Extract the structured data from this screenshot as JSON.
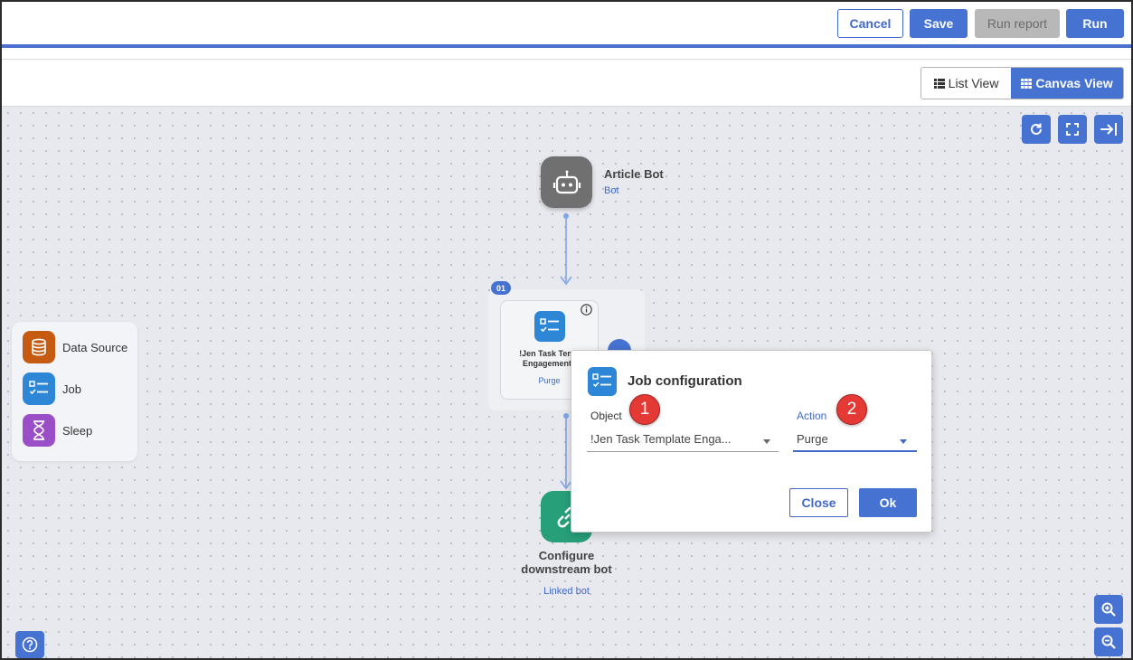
{
  "toolbar": {
    "cancel_label": "Cancel",
    "save_label": "Save",
    "run_report_label": "Run report",
    "run_label": "Run"
  },
  "view_switch": {
    "list_label": "List View",
    "canvas_label": "Canvas View",
    "active": "Canvas View"
  },
  "palette": {
    "items": [
      {
        "label": "Data Source",
        "icon": "database-icon",
        "color": "#c55a11"
      },
      {
        "label": "Job",
        "icon": "task-list-icon",
        "color": "#2d86d6"
      },
      {
        "label": "Sleep",
        "icon": "hourglass-icon",
        "color": "#9b4fc7"
      }
    ]
  },
  "nodes": {
    "bot": {
      "title": "Article Bot",
      "subtitle": "Bot",
      "icon": "robot-icon",
      "color": "#707070"
    },
    "job": {
      "badge": "01",
      "title_line1": "!Jen Task Temp",
      "title_line2": "Engagements",
      "subtitle": "Purge",
      "icon": "task-list-icon"
    },
    "linked": {
      "title_line1": "Configure",
      "title_line2": "downstream bot",
      "subtitle": "Linked bot",
      "icon": "link-icon",
      "color": "#27a07a"
    }
  },
  "dialog": {
    "title": "Job configuration",
    "object_label": "Object",
    "object_value": "!Jen Task Template Enga...",
    "action_label": "Action",
    "action_value": "Purge",
    "close_label": "Close",
    "ok_label": "Ok",
    "callouts": [
      "1",
      "2"
    ]
  },
  "colors": {
    "accent": "#4672d1",
    "callout": "#e53935"
  }
}
